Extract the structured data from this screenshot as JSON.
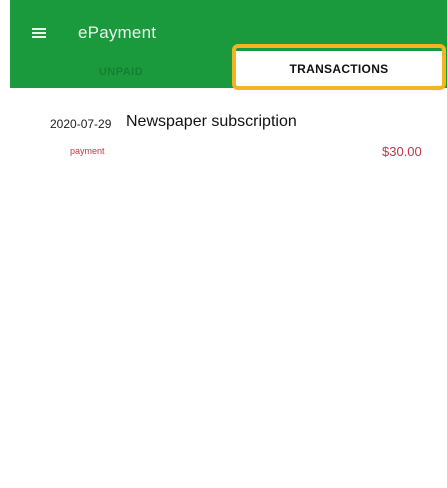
{
  "app_bar": {
    "title": "ePayment",
    "menu_icon": "hamburger-menu-icon",
    "background_color": "#1a9a3d"
  },
  "tabs": [
    {
      "label": "UNPAID",
      "selected": false
    },
    {
      "label": "TRANSACTIONS",
      "selected": true
    }
  ],
  "highlight_color": "#f4b324",
  "transactions": [
    {
      "date": "2020-07-29",
      "title": "Newspaper subscription",
      "type": "payment",
      "amount": "$30.00",
      "amount_color": "#c0354a"
    }
  ]
}
